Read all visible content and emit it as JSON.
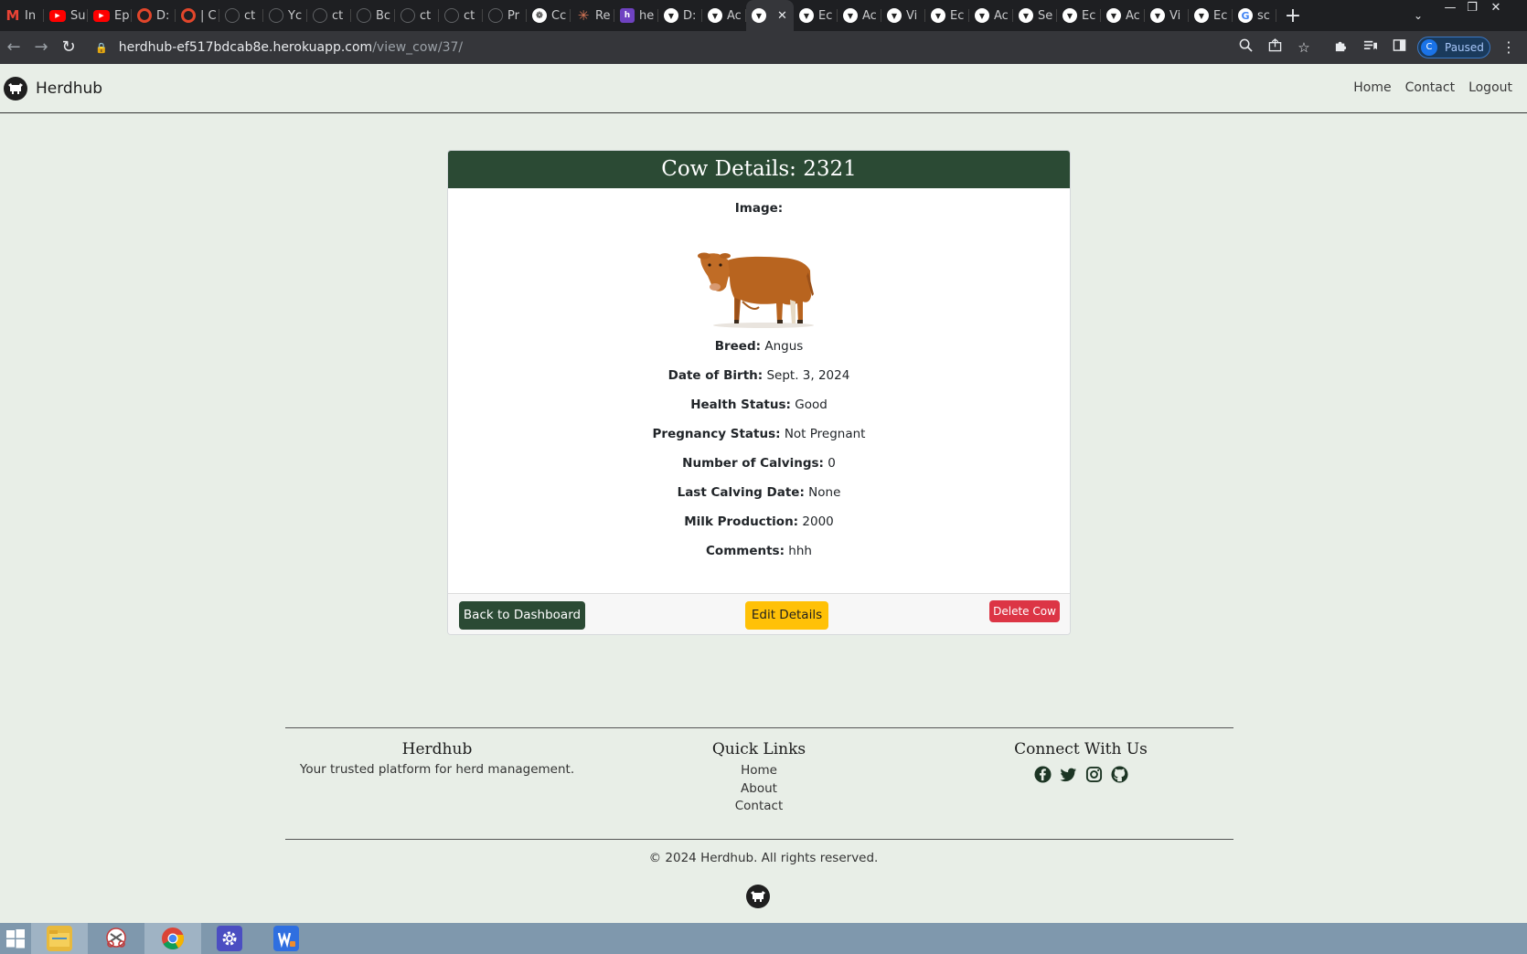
{
  "browser": {
    "tabs": [
      {
        "label": "In",
        "icon": "gmail-icon"
      },
      {
        "label": "Su",
        "icon": "youtube-icon"
      },
      {
        "label": "Ep",
        "icon": "youtube-icon"
      },
      {
        "label": "D:",
        "icon": "opera-icon"
      },
      {
        "label": "| C",
        "icon": "opera-icon"
      },
      {
        "label": "ct",
        "icon": "github-icon"
      },
      {
        "label": "Yc",
        "icon": "github-icon"
      },
      {
        "label": "ct",
        "icon": "github-icon"
      },
      {
        "label": "Bc",
        "icon": "github-icon"
      },
      {
        "label": "ct",
        "icon": "github-icon"
      },
      {
        "label": "ct",
        "icon": "github-icon"
      },
      {
        "label": "Pr",
        "icon": "github-icon"
      },
      {
        "label": "Cc",
        "icon": "openai-icon"
      },
      {
        "label": "Re",
        "icon": "claude-icon"
      },
      {
        "label": "he",
        "icon": "heroku-icon"
      },
      {
        "label": "D:",
        "icon": "cow-icon"
      },
      {
        "label": "Ac",
        "icon": "cow-icon"
      },
      {
        "label": "",
        "icon": "cow-icon",
        "active": true
      },
      {
        "label": "Ec",
        "icon": "cow-icon"
      },
      {
        "label": "Ac",
        "icon": "cow-icon"
      },
      {
        "label": "Vi",
        "icon": "cow-icon"
      },
      {
        "label": "Ec",
        "icon": "cow-icon"
      },
      {
        "label": "Ac",
        "icon": "cow-icon"
      },
      {
        "label": "Se",
        "icon": "cow-icon"
      },
      {
        "label": "Ec",
        "icon": "cow-icon"
      },
      {
        "label": "Ac",
        "icon": "cow-icon"
      },
      {
        "label": "Vi",
        "icon": "cow-icon"
      },
      {
        "label": "Ec",
        "icon": "cow-icon"
      },
      {
        "label": "sc",
        "icon": "google-icon"
      }
    ],
    "url_host": "herdhub-ef517bdcab8e.herokuapp.com",
    "url_path": "/view_cow/37/",
    "profile_initial": "C",
    "profile_status": "Paused"
  },
  "navbar": {
    "brand": "Herdhub",
    "links": [
      "Home",
      "Contact",
      "Logout"
    ]
  },
  "card": {
    "title": "Cow Details: 2321",
    "image_label": "Image:",
    "details": [
      {
        "label": "Breed:",
        "value": "Angus"
      },
      {
        "label": "Date of Birth:",
        "value": "Sept. 3, 2024"
      },
      {
        "label": "Health Status:",
        "value": "Good"
      },
      {
        "label": "Pregnancy Status:",
        "value": "Not Pregnant"
      },
      {
        "label": "Number of Calvings:",
        "value": "0"
      },
      {
        "label": "Last Calving Date:",
        "value": "None"
      },
      {
        "label": "Milk Production:",
        "value": "2000"
      },
      {
        "label": "Comments:",
        "value": "hhh"
      }
    ],
    "buttons": {
      "back": "Back to Dashboard",
      "edit": "Edit Details",
      "delete": "Delete Cow"
    }
  },
  "footer": {
    "col1_title": "Herdhub",
    "col1_text": "Your trusted platform for herd management.",
    "col2_title": "Quick Links",
    "col2_links": [
      "Home",
      "About",
      "Contact"
    ],
    "col3_title": "Connect With Us",
    "social": [
      "facebook-icon",
      "twitter-icon",
      "instagram-icon",
      "github-icon"
    ],
    "copyright": "© 2024 Herdhub. All rights reserved."
  },
  "colors": {
    "page_bg": "#e8eee7",
    "header_green": "#2b4a34",
    "warning_yellow": "#ffc107",
    "danger_red": "#dc3545"
  }
}
